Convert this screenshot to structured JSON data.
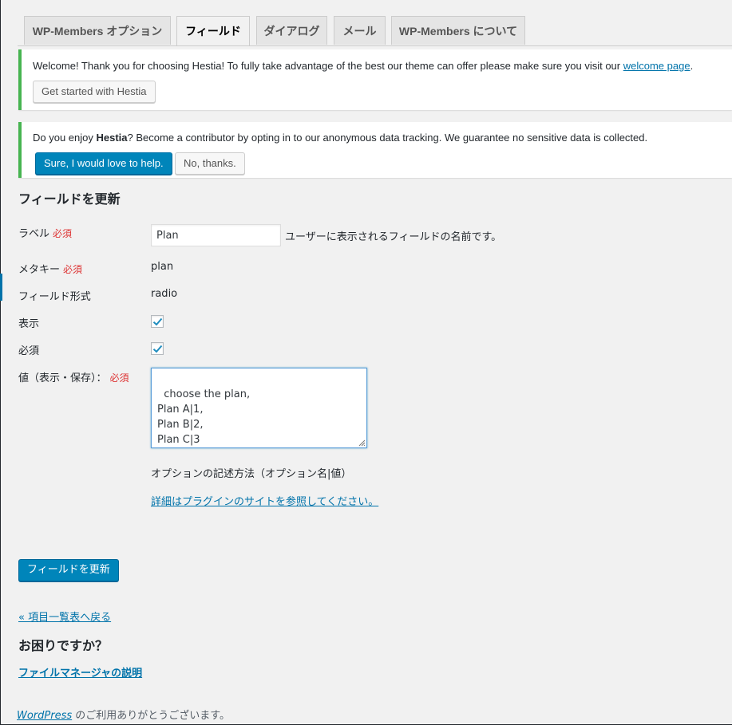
{
  "tabs": [
    {
      "label": "WP-Members オプション",
      "active": false
    },
    {
      "label": "フィールド",
      "active": true
    },
    {
      "label": "ダイアログ",
      "active": false
    },
    {
      "label": "メール",
      "active": false
    },
    {
      "label": "WP-Members について",
      "active": false
    }
  ],
  "notice_welcome": {
    "text_before": "Welcome! Thank you for choosing Hestia! To fully take advantage of the best our theme can offer please make sure you visit our ",
    "link_text": "welcome page",
    "text_after": ".",
    "button_label": "Get started with Hestia",
    "accent_color": "#46b450"
  },
  "notice_tracking": {
    "text_before": "Do you enjoy ",
    "brand": "Hestia",
    "text_after": "? Become a contributor by opting in to our anonymous data tracking. We guarantee no sensitive data is collected.",
    "accept_label": "Sure, I would love to help.",
    "decline_label": "No, thanks.",
    "accent_color": "#46b450"
  },
  "form": {
    "title": "フィールドを更新",
    "required_mark": "必須",
    "label_label": "ラベル",
    "label_value": "Plan",
    "label_desc": "ユーザーに表示されるフィールドの名前です。",
    "metakey_label": "メタキー",
    "metakey_value": "plan",
    "type_label": "フィールド形式",
    "type_value": "radio",
    "display_label": "表示",
    "display_checked": true,
    "required_label": "必須",
    "required_checked": true,
    "values_label": "値（表示・保存）：",
    "values_text": "choose the plan,\nPlan A|1,\nPlan B|2,\nPlan C|3",
    "values_help": "オプションの記述方法（オプション名|値）",
    "values_link": "詳細はプラグインのサイトを参照してください。",
    "submit_label": "フィールドを更新"
  },
  "back_link": "« 項目一覧表へ戻る",
  "help": {
    "title": "お困りですか？",
    "link": "ファイルマネージャの説明"
  },
  "footer": {
    "link": "WordPress",
    "text": " のご利用ありがとうございます。"
  },
  "colors": {
    "primary": "#0085ba",
    "link": "#0073aa",
    "required": "#dd3333"
  }
}
